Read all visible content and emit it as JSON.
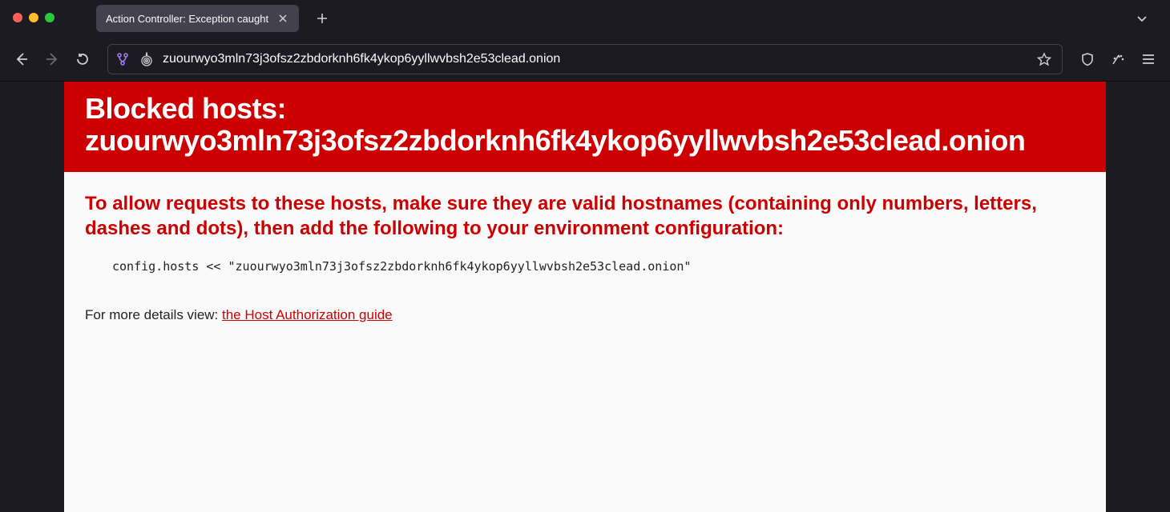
{
  "tab": {
    "title": "Action Controller: Exception caught"
  },
  "url": "zuourwyo3mln73j3ofsz2zbdorknh6fk4ykop6yyllwvbsh2e53clead.onion",
  "page": {
    "heading_prefix": "Blocked hosts: ",
    "heading_host": "zuourwyo3mln73j3ofsz2zbdorknh6fk4ykop6yyllwvbsh2e53clead.onion",
    "subheading": "To allow requests to these hosts, make sure they are valid hostnames (containing only numbers, letters, dashes and dots), then add the following to your environment configuration:",
    "code": "config.hosts << \"zuourwyo3mln73j3ofsz2zbdorknh6fk4ykop6yyllwvbsh2e53clead.onion\"",
    "details_prefix": "For more details view: ",
    "details_link": "the Host Authorization guide"
  }
}
